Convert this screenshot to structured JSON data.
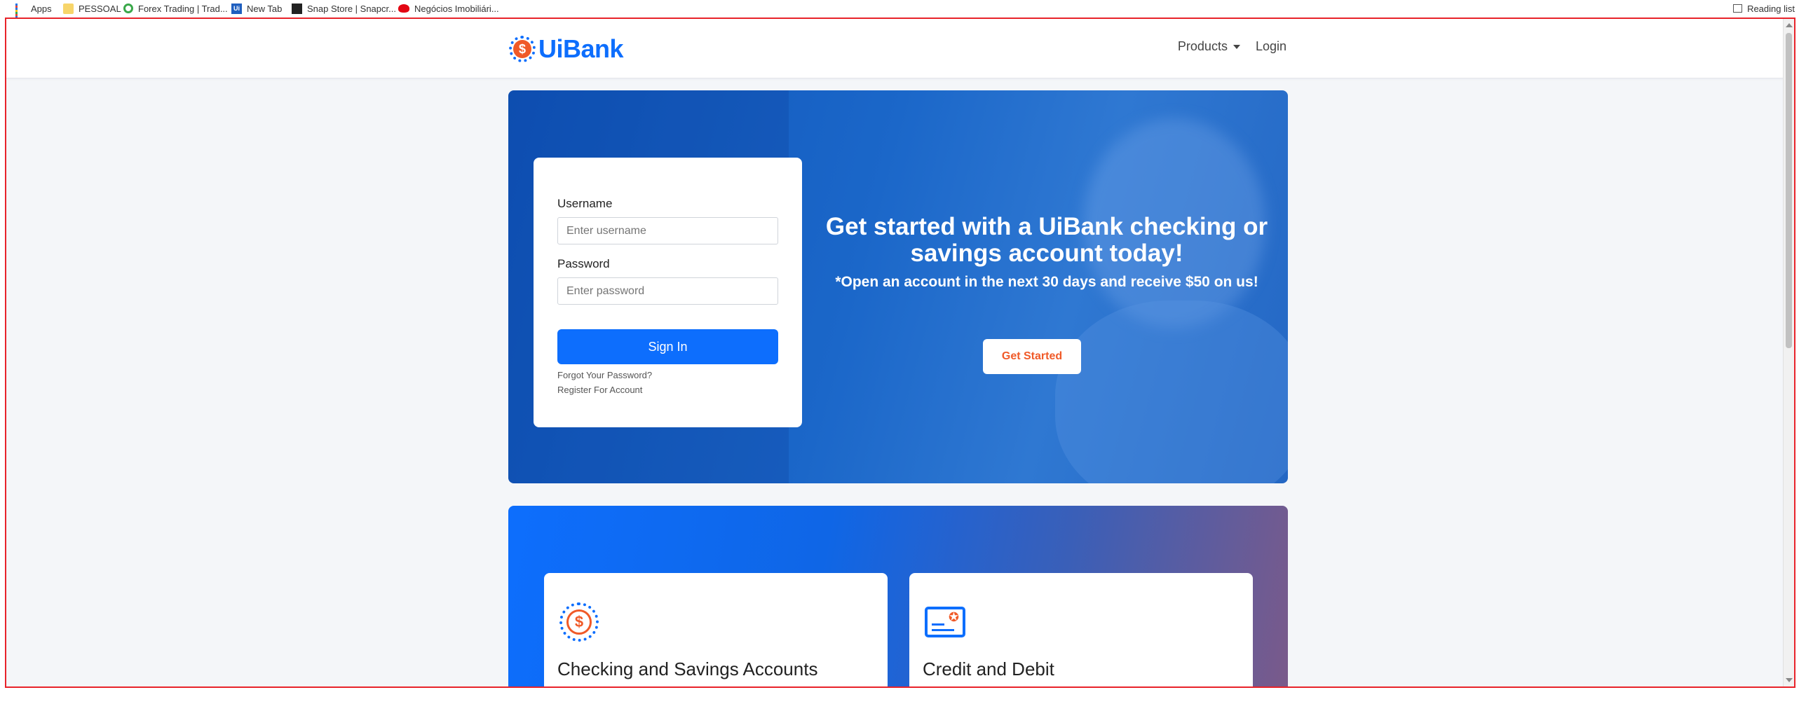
{
  "bookmarks": {
    "items": [
      {
        "label": "Apps",
        "icon": "apps-grid-icon"
      },
      {
        "label": "PESSOAL",
        "icon": "folder-icon"
      },
      {
        "label": "Forex Trading | Trad...",
        "icon": "forex-icon"
      },
      {
        "label": "New Tab",
        "icon": "ui-icon"
      },
      {
        "label": "Snap Store | Snapcr...",
        "icon": "snap-icon"
      },
      {
        "label": "Negócios Imobiliári...",
        "icon": "santander-icon"
      }
    ],
    "reading_list": "Reading list"
  },
  "navbar": {
    "logo_symbol": "$",
    "logo_text": "UiBank",
    "products_label": "Products",
    "login_label": "Login"
  },
  "login": {
    "username_label": "Username",
    "username_placeholder": "Enter username",
    "password_label": "Password",
    "password_placeholder": "Enter password",
    "sign_in_label": "Sign In",
    "forgot_label": "Forgot Your Password?",
    "register_label": "Register For Account"
  },
  "hero": {
    "title": "Get started with a UiBank checking or savings account today!",
    "subtitle": "*Open an account in the next 30 days and receive $50 on us!",
    "cta_label": "Get Started"
  },
  "products": {
    "cards": [
      {
        "title": "Checking and Savings Accounts",
        "icon": "dollar-badge-icon",
        "icon_symbol": "$"
      },
      {
        "title": "Credit and Debit",
        "icon": "credit-card-icon",
        "icon_symbol": "✪"
      }
    ]
  },
  "colors": {
    "brand_blue": "#0d6efd",
    "accent_orange": "#f05a28",
    "viewport_border": "#e8232a"
  }
}
